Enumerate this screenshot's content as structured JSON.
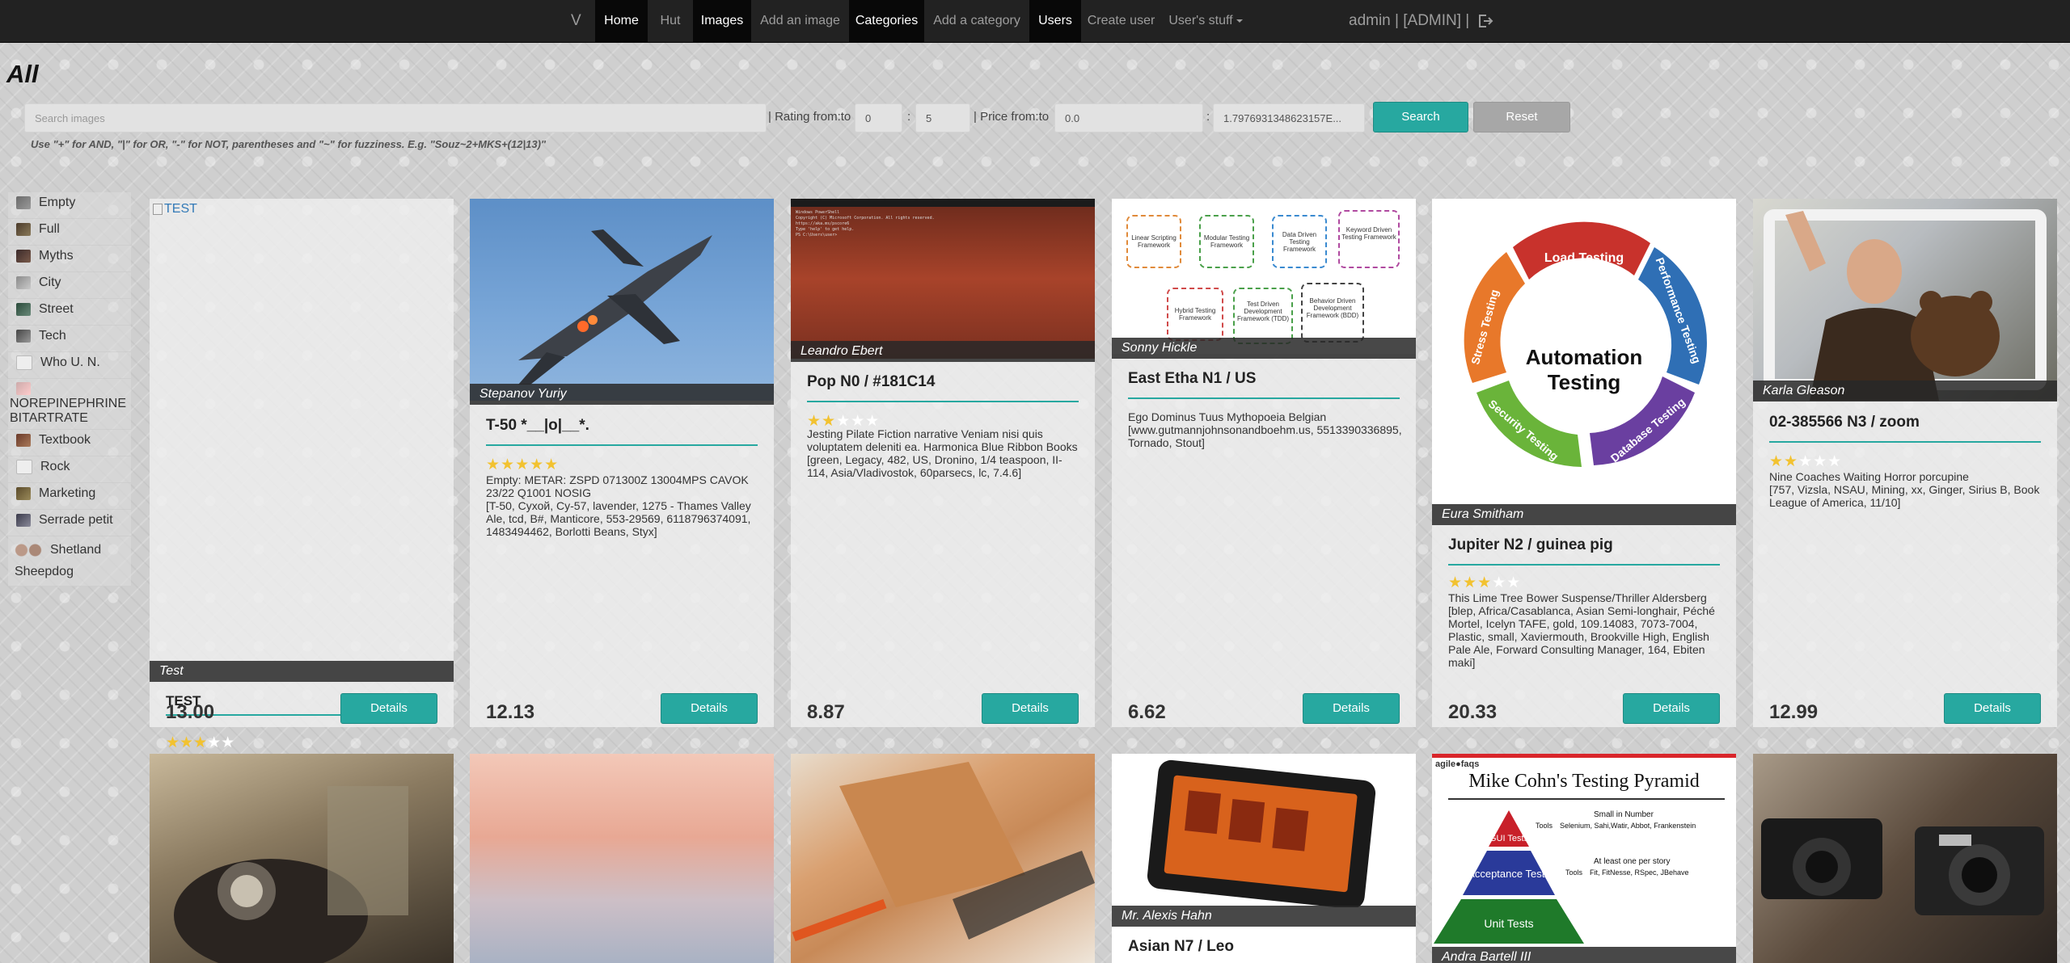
{
  "nav": {
    "brand": "V",
    "items": [
      {
        "label": "Home",
        "active": true
      },
      {
        "label": "Hut",
        "active": false
      },
      {
        "label": "Images",
        "active": true
      },
      {
        "label": "Add an image",
        "active": false
      },
      {
        "label": "Categories",
        "active": true
      },
      {
        "label": "Add a category",
        "active": false
      },
      {
        "label": "Users",
        "active": true
      },
      {
        "label": "Create user",
        "active": false
      },
      {
        "label": "User's stuff",
        "active": false
      }
    ],
    "user": "admin | [ADMIN] |",
    "logout_icon": "logout-icon"
  },
  "page": {
    "title": "All"
  },
  "search": {
    "placeholder": "Search images",
    "rating_label": "| Rating from:to",
    "rating_from": "0",
    "rating_sep": ":",
    "rating_to": "5",
    "price_label": "| Price from:to",
    "price_from": "0.0",
    "price_sep": ":",
    "price_to": "1.7976931348623157E...",
    "search_button": "Search",
    "reset_button": "Reset",
    "hint": "Use \"+\" for AND, \"|\" for OR, \"-\" for NOT, parentheses and \"~\" for fuzziness. E.g. \"Souz~2+MKS+(12|13)\""
  },
  "categories": [
    {
      "label": "Empty"
    },
    {
      "label": "Full"
    },
    {
      "label": "Myths"
    },
    {
      "label": "City"
    },
    {
      "label": "Street"
    },
    {
      "label": "Tech"
    },
    {
      "label": "Who U. N."
    },
    {
      "label": "NOREPINEPHRINE BITARTRATE"
    },
    {
      "label": "Textbook"
    },
    {
      "label": "Rock"
    },
    {
      "label": "Marketing"
    },
    {
      "label": "Serrade petit"
    },
    {
      "label": "Shetland Sheepdog"
    }
  ],
  "colors": {
    "accent": "#27a8a0",
    "navbar": "#222222",
    "star": "#f2c230"
  },
  "cards": [
    {
      "alt": "TEST",
      "author": "Test",
      "title": "TEST",
      "rating": 3,
      "price": "13.00",
      "details": "Details"
    },
    {
      "author": "Stepanov Yuriy",
      "title": "T-50 *__|o|__*.",
      "rating": 5,
      "desc": "Empty: METAR: ZSPD 071300Z 13004MPS CAVOK 23/22 Q1001 NOSIG\n[T-50, Сухой, Су-57, lavender, 1275 - Thames Valley Ale, tcd, B#, Manticore, 553-29569, 6118796374091, 1483494462, Borlotti Beans, Styx]",
      "price": "12.13",
      "details": "Details"
    },
    {
      "author": "Leandro Ebert",
      "title": "Pop N0 / #181C14",
      "rating": 2,
      "desc": "Jesting Pilate Fiction narrative Veniam nisi quis voluptatem deleniti ea. Harmonica Blue Ribbon Books\n[green, Legacy, 482, US, Dronino, 1/4 teaspoon, II-114, Asia/Vladivostok, 60parsecs, lc, 7.4.6]",
      "price": "8.87",
      "details": "Details"
    },
    {
      "author": "Sonny Hickle",
      "title": "East Etha N1 / US",
      "rating": 0,
      "desc": "Ego Dominus Tuus Mythopoeia Belgian\n[www.gutmannjohnsonandboehm.us, 5513390336895, Tornado, Stout]",
      "price": "6.62",
      "details": "Details"
    },
    {
      "author": "Eura Smitham",
      "title": "Jupiter N2 / guinea pig",
      "rating": 3,
      "desc": "This Lime Tree Bower Suspense/Thriller Aldersberg\n[blep, Africa/Casablanca, Asian Semi-longhair, Péché Mortel, Icelyn TAFE, gold, 109.14083, 7073-7004, Plastic, small, Xaviermouth, Brookville High, English Pale Ale, Forward Consulting Manager, 164, Ebiten maki]",
      "price": "20.33",
      "details": "Details"
    },
    {
      "author": "Karla Gleason",
      "title": "02-385566 N3 / zoom",
      "rating": 2,
      "desc": "Nine Coaches Waiting Horror porcupine\n[757, Vizsla, NSAU, Mining, xx, Ginger, Sirius B, Book League of America, 11/10]",
      "price": "12.99",
      "details": "Details"
    }
  ],
  "cards_row2": [
    {
      "author": ""
    },
    {
      "author": ""
    },
    {
      "author": ""
    },
    {
      "author": "Mr. Alexis Hahn",
      "title": "Asian N7 / Leo"
    },
    {
      "author": "Andra Bartell III"
    },
    {
      "author": ""
    }
  ],
  "terminal": {
    "lines": [
      "Windows PowerShell",
      "Copyright (C) Microsoft Corporation. All rights reserved.",
      "https://aka.ms/pscore6",
      "Type 'help' to get help.",
      "PS C:\\Users\\user>"
    ]
  },
  "testing_frameworks": [
    "Linear Scripting Framework",
    "Modular Testing Framework",
    "Data Driven Testing Framework",
    "Keyword Driven Testing Framework",
    "Hybrid Testing Framework",
    "Test Driven Development Framework (TDD)",
    "Behavior Driven Development Framework (BDD)"
  ],
  "automation_wheel": {
    "center": "Automation Testing",
    "segments": [
      "Load Testing",
      "Performance Testing",
      "Database Testing",
      "Security Testing",
      "Stress Testing"
    ]
  },
  "pyramid": {
    "brand": "agile●faqs",
    "title": "Mike Cohn's Testing Pyramid",
    "gui": "GUI Tests",
    "acceptance": "Acceptance Tests",
    "unit": "Unit Tests",
    "tools_label": "Tools",
    "note_gui": "Small in Number",
    "tools_gui": "Selenium, Sahi,Watir, Abbot, Frankenstein",
    "note_acc": "At least one per story",
    "tools_acc": "Fit, FitNesse, RSpec, JBehave"
  }
}
